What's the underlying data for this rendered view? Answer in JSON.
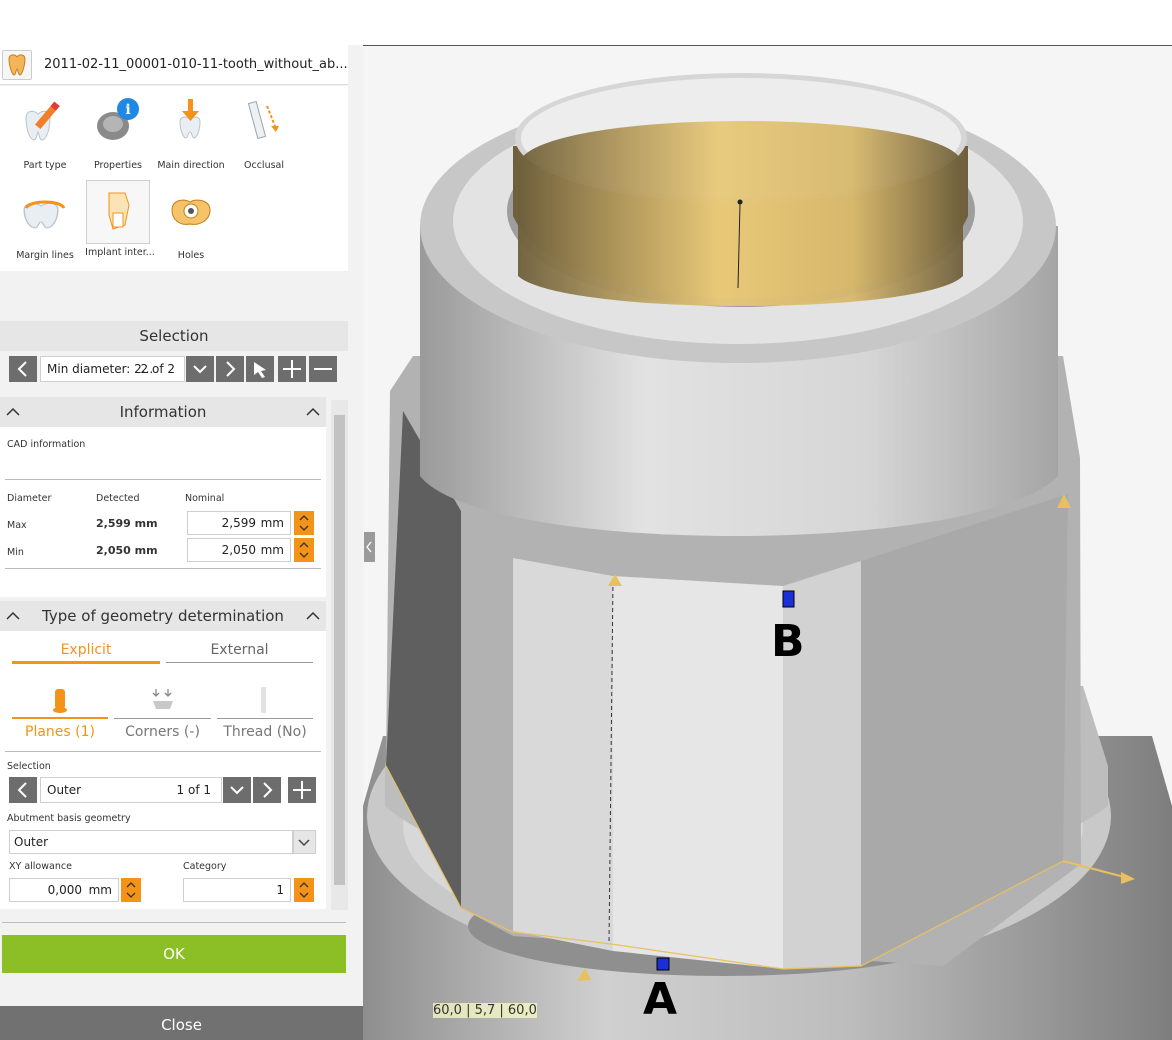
{
  "window": {
    "title": "2011-02-11_00001-010-11-tooth_without_ab..."
  },
  "toolbox": {
    "tools": [
      {
        "label": "Part type",
        "icon": "pencil-tooth-icon"
      },
      {
        "label": "Properties",
        "icon": "info-tooth-icon"
      },
      {
        "label": "Main direction",
        "icon": "arrow-down-tooth-icon"
      },
      {
        "label": "Occlusal",
        "icon": "occlusal-arrow-icon"
      },
      {
        "label": "Margin lines",
        "icon": "margin-line-icon"
      },
      {
        "label": "Implant inter...",
        "icon": "implant-interface-icon"
      },
      {
        "label": "Holes",
        "icon": "holes-icon"
      }
    ]
  },
  "selection": {
    "heading": "Selection",
    "value": "Min diameter: 2...",
    "counter": "2 of 2"
  },
  "information": {
    "heading": "Information",
    "cad_label": "CAD information",
    "col_diameter": "Diameter",
    "col_detected": "Detected",
    "col_nominal": "Nominal",
    "rows": [
      {
        "label": "Max",
        "detected": "2,599 mm",
        "nominal": "2,599",
        "unit": "mm"
      },
      {
        "label": "Min",
        "detected": "2,050 mm",
        "nominal": "2,050",
        "unit": "mm"
      }
    ]
  },
  "geometry": {
    "heading": "Type of geometry determination",
    "tabs": [
      "Explicit",
      "External"
    ],
    "subtabs": [
      "Planes (1)",
      "Corners (-)",
      "Thread (No)"
    ],
    "selection_label": "Selection",
    "selection_value": "Outer",
    "selection_counter": "1 of 1",
    "abutment_label": "Abutment basis geometry",
    "abutment_value": "Outer",
    "xy_label": "XY allowance",
    "xy_value": "0,000",
    "xy_unit": "mm",
    "category_label": "Category",
    "category_value": "1"
  },
  "footer": {
    "ok": "OK",
    "close": "Close"
  },
  "viewport": {
    "coords": "60,0 | 5,7 | 60,0",
    "marker_a": "A",
    "marker_b": "B"
  },
  "colors": {
    "accent": "#f39318",
    "ok": "#8cbf26",
    "marker": "#1a2fd6"
  }
}
